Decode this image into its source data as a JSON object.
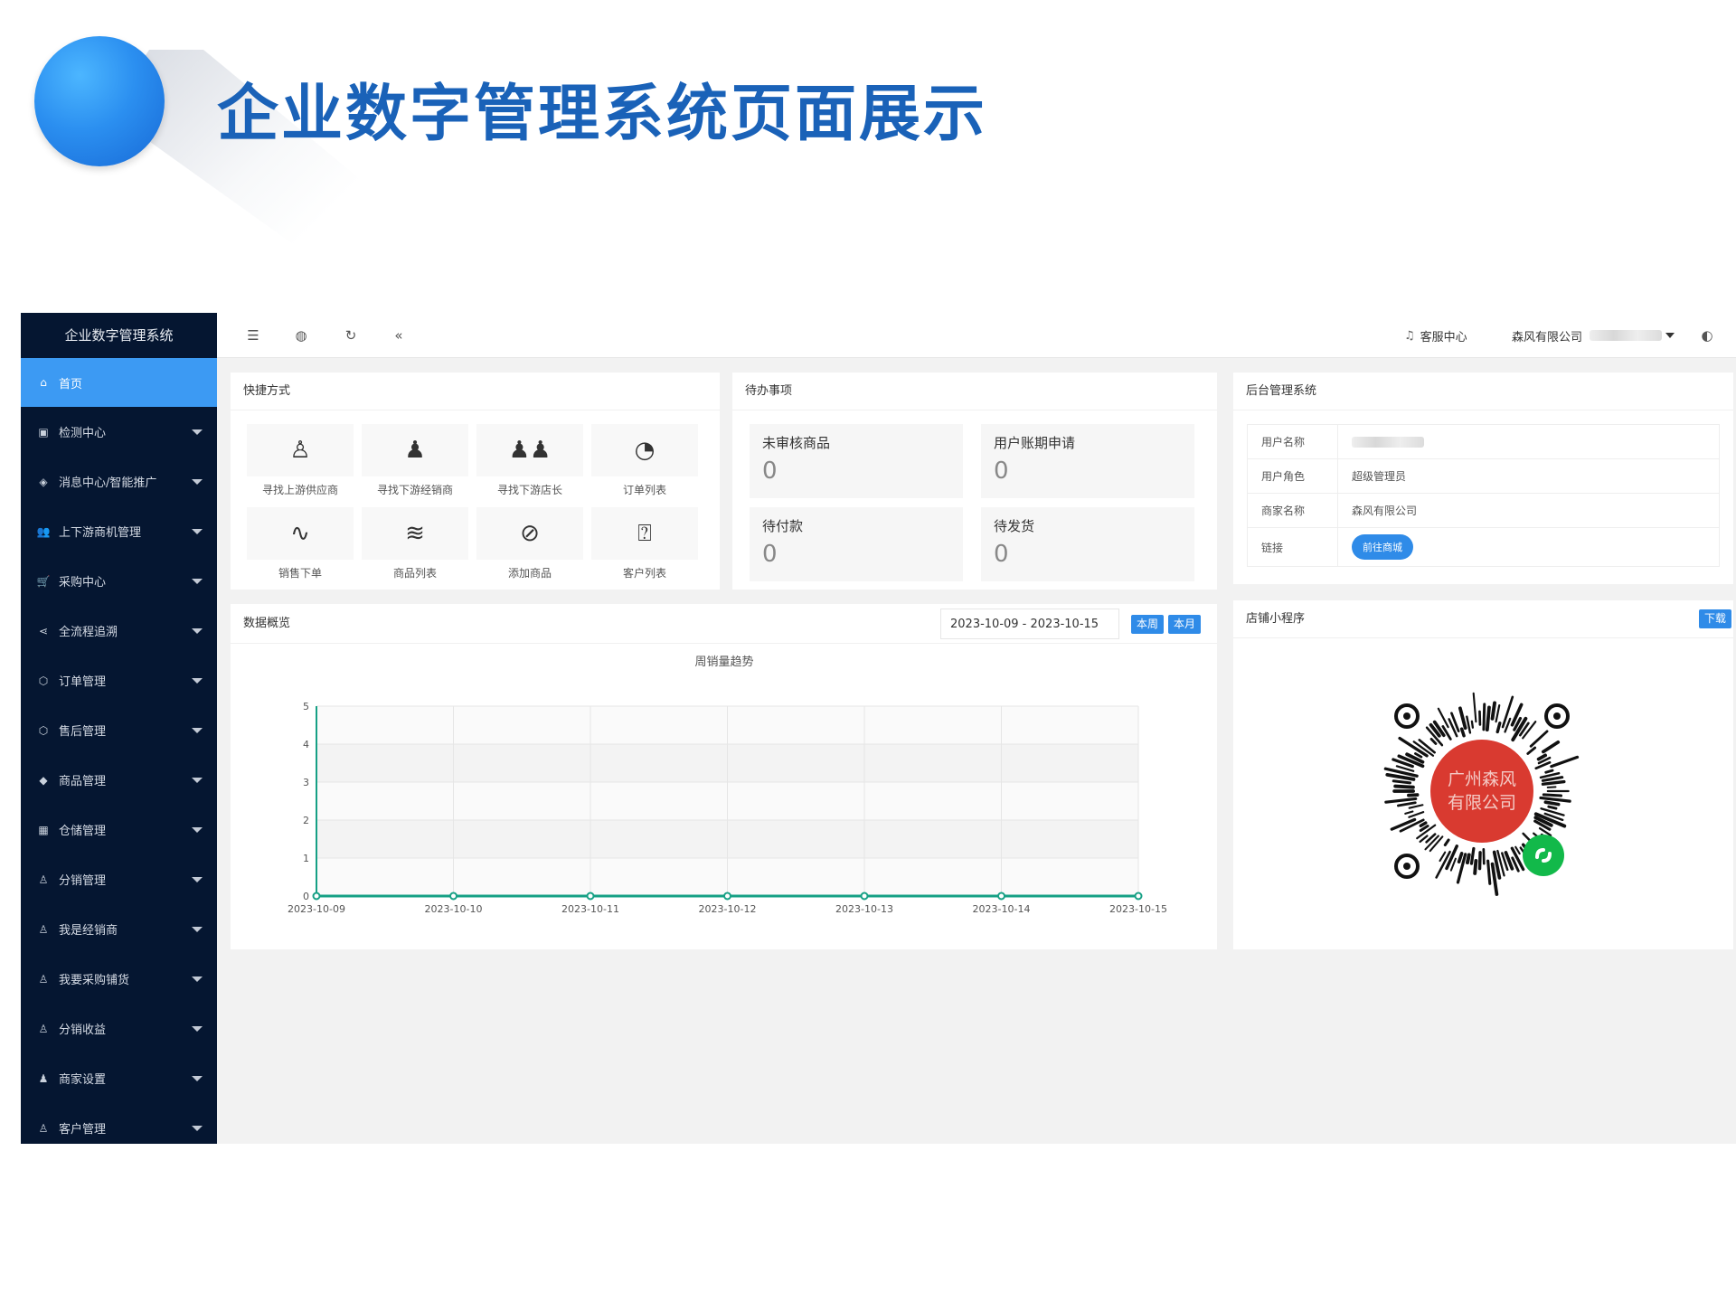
{
  "slide": {
    "title": "企业数字管理系统页面展示"
  },
  "sidebar": {
    "title": "企业数字管理系统",
    "items": [
      {
        "label": "首页",
        "icon": "home-icon",
        "active": true
      },
      {
        "label": "检测中心",
        "icon": "monitor-icon"
      },
      {
        "label": "消息中心/智能推广",
        "icon": "diamond-icon"
      },
      {
        "label": "上下游商机管理",
        "icon": "users-icon"
      },
      {
        "label": "采购中心",
        "icon": "cart-icon"
      },
      {
        "label": "全流程追溯",
        "icon": "share-icon"
      },
      {
        "label": "订单管理",
        "icon": "box-icon"
      },
      {
        "label": "售后管理",
        "icon": "box-icon"
      },
      {
        "label": "商品管理",
        "icon": "gem-icon"
      },
      {
        "label": "仓储管理",
        "icon": "warehouse-icon"
      },
      {
        "label": "分销管理",
        "icon": "user-outline-icon"
      },
      {
        "label": "我是经销商",
        "icon": "user-outline-icon"
      },
      {
        "label": "我要采购铺货",
        "icon": "user-outline-icon"
      },
      {
        "label": "分销收益",
        "icon": "user-outline-icon"
      },
      {
        "label": "商家设置",
        "icon": "user-icon"
      },
      {
        "label": "客户管理",
        "icon": "user-outline-icon"
      }
    ]
  },
  "topbar": {
    "service_label": "客服中心",
    "company_label": "森风有限公司"
  },
  "shortcuts": {
    "title": "快捷方式",
    "items": [
      {
        "label": "寻找上游供应商",
        "icon": "user-outline-icon"
      },
      {
        "label": "寻找下游经销商",
        "icon": "user-icon"
      },
      {
        "label": "寻找下游店长",
        "icon": "users-icon"
      },
      {
        "label": "订单列表",
        "icon": "gauge-icon"
      },
      {
        "label": "销售下单",
        "icon": "pulse-icon"
      },
      {
        "label": "商品列表",
        "icon": "layers-icon"
      },
      {
        "label": "添加商品",
        "icon": "compass-icon"
      },
      {
        "label": "客户列表",
        "icon": "help-doc-icon"
      }
    ]
  },
  "todo": {
    "title": "待办事项",
    "items": [
      {
        "label": "未审核商品",
        "value": "0"
      },
      {
        "label": "用户账期申请",
        "value": "0"
      },
      {
        "label": "待付款",
        "value": "0"
      },
      {
        "label": "待发货",
        "value": "0"
      }
    ]
  },
  "admin": {
    "title": "后台管理系统",
    "rows": [
      {
        "key": "用户名称",
        "value": ""
      },
      {
        "key": "用户角色",
        "value": "超级管理员"
      },
      {
        "key": "商家名称",
        "value": "森风有限公司"
      },
      {
        "key": "链接",
        "value": "前往商城"
      }
    ]
  },
  "overview": {
    "title": "数据概览",
    "date_range": "2023-10-09 - 2023-10-15",
    "btn_week": "本周",
    "btn_month": "本月"
  },
  "chart_data": {
    "type": "line",
    "title": "周销量趋势",
    "categories": [
      "2023-10-09",
      "2023-10-10",
      "2023-10-11",
      "2023-10-12",
      "2023-10-13",
      "2023-10-14",
      "2023-10-15"
    ],
    "series": [
      {
        "values": [
          0,
          0,
          0,
          0,
          0,
          0,
          0
        ],
        "color": "#16a085"
      }
    ],
    "ylim": [
      0,
      5
    ],
    "yticks": [
      "0",
      "1",
      "2",
      "3",
      "4",
      "5"
    ],
    "grid": true
  },
  "miniprogram": {
    "title": "店铺小程序",
    "download_label": "下载",
    "qr_center_line1": "广州森风",
    "qr_center_line2": "有限公司"
  }
}
